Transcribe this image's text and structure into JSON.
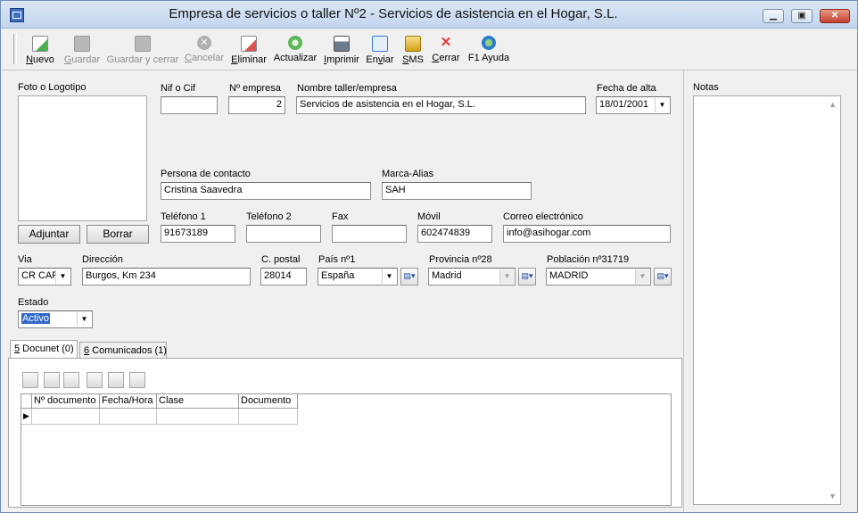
{
  "window": {
    "title": "Empresa de servicios o taller Nº2 - Servicios de asistencia en el Hogar, S.L.",
    "minimize_glyph": "▁",
    "maximize_glyph": "▣",
    "close_glyph": "✕"
  },
  "toolbar": {
    "items": [
      {
        "label": "Nuevo",
        "hotkey": "N",
        "rest": "uevo",
        "icon": "new-doc-icon",
        "color": "#4caf50",
        "enabled": true
      },
      {
        "label": "Guardar",
        "hotkey": "G",
        "rest": "uardar",
        "icon": "save-icon",
        "color": "#9e9e9e",
        "enabled": false
      },
      {
        "label": "Guardar y cerrar",
        "icon": "save-close-icon",
        "color": "#9e9e9e",
        "enabled": false
      },
      {
        "label": "Cancelar",
        "hotkey": "C",
        "rest": "ancelar",
        "icon": "cancel-icon",
        "color": "#a0a0a0",
        "enabled": false
      },
      {
        "label": "Eliminar",
        "hotkey": "E",
        "rest": "liminar",
        "icon": "delete-doc-icon",
        "color": "#d9534f",
        "enabled": true
      },
      {
        "label": "Actualizar",
        "icon": "refresh-icon",
        "color": "#5cb85c",
        "enabled": true
      },
      {
        "label": "Imprimir",
        "hotkey": "I",
        "rest": "mprimir",
        "icon": "printer-icon",
        "color": "#6b7b8c",
        "enabled": true
      },
      {
        "label": "Enviar",
        "hotkey": "v",
        "pre": "En",
        "rest": "iar",
        "icon": "send-icon",
        "color": "#3a7bd5",
        "enabled": true
      },
      {
        "label": "SMS",
        "hotkey": "S",
        "rest": "MS",
        "icon": "sms-icon",
        "color": "#d4a017",
        "enabled": true
      },
      {
        "label": "Cerrar",
        "hotkey": "C",
        "rest": "errar",
        "icon": "close-x-icon",
        "color": "#e53935",
        "enabled": true
      },
      {
        "label": "F1 Ayuda",
        "icon": "help-icon",
        "color": "#43a047",
        "enabled": true
      }
    ]
  },
  "form": {
    "logo_label": "Foto o Logotipo",
    "attach_button": "Adjuntar",
    "delete_button": "Borrar",
    "nif_label": "Nif o Cif",
    "nif_value": "",
    "num_label": "Nº empresa",
    "num_value": "2",
    "name_label": "Nombre taller/empresa",
    "name_value": "Servicios de asistencia en el Hogar, S.L.",
    "date_label": "Fecha de alta",
    "date_value": "18/01/2001",
    "contact_label": "Persona de contacto",
    "contact_value": "Cristina Saavedra",
    "alias_label": "Marca-Alias",
    "alias_value": "SAH",
    "phone1_label": "Teléfono 1",
    "phone1_value": "91673189",
    "phone2_label": "Teléfono 2",
    "phone2_value": "",
    "fax_label": "Fax",
    "fax_value": "",
    "mobile_label": "Móvil",
    "mobile_value": "602474839",
    "email_label": "Correo electrónico",
    "email_value": "info@asihogar.com",
    "via_label": "Via",
    "via_value": "CR CAR",
    "address_label": "Dirección",
    "address_value": "Burgos, Km 234",
    "postal_label": "C. postal",
    "postal_value": "28014",
    "country_label": "País nº1",
    "country_value": "España",
    "province_label": "Provincia nº28",
    "province_value": "Madrid",
    "town_label": "Población nº31719",
    "town_value": "MADRID",
    "status_label": "Estado",
    "status_value": "Activo",
    "notes_label": "Notas"
  },
  "tabs": [
    {
      "label": "5 Docunet (0)",
      "hotkey": "5",
      "rest": " Docunet (0)"
    },
    {
      "label": "6 Comunicados (1)",
      "hotkey": "6",
      "rest": " Comunicados (1)"
    }
  ],
  "grid": {
    "columns": [
      "Nº documento",
      "Fecha/Hora",
      "Clase",
      "Documento"
    ],
    "row_indicator": "▶"
  }
}
